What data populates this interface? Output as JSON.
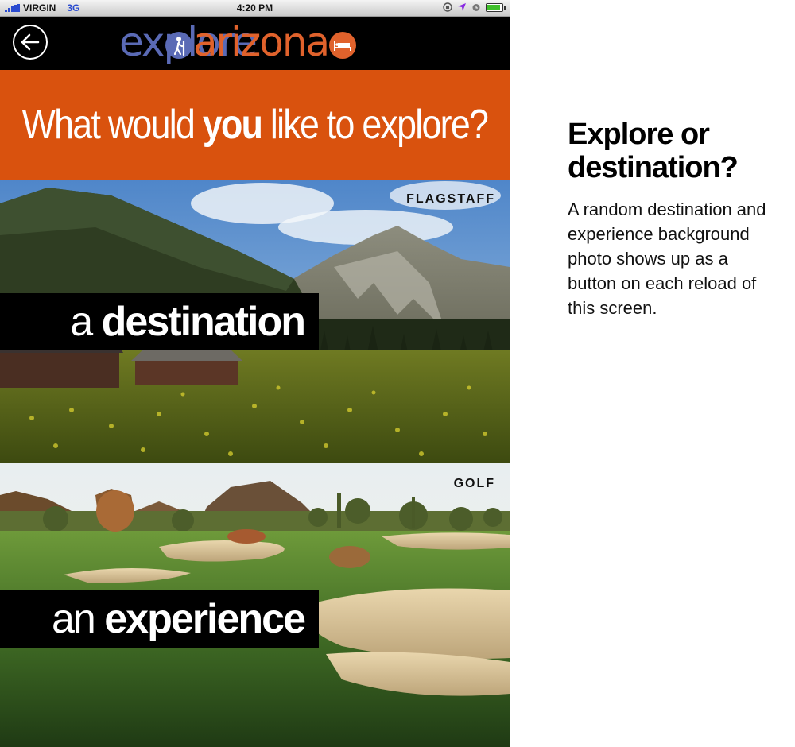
{
  "status": {
    "carrier": "VIRGIN",
    "network": "3G",
    "time": "4:20 PM"
  },
  "nav": {
    "logo_part1": "explore",
    "logo_part2": "arizona"
  },
  "header": {
    "question_before": "What would ",
    "question_bold": "you",
    "question_after": " like to explore?"
  },
  "destination": {
    "tag": "FLAGSTAFF",
    "prefix": "a ",
    "word": "destination"
  },
  "experience": {
    "tag": "GOLF",
    "prefix": "an ",
    "word": "experience"
  },
  "side": {
    "title": "Explore or destination?",
    "description": "A random destination and experience background photo shows up as a button on each reload of this screen."
  },
  "colors": {
    "header_orange": "#d9520e",
    "logo_blue": "#5a6ab5",
    "logo_orange": "#e0622c"
  }
}
